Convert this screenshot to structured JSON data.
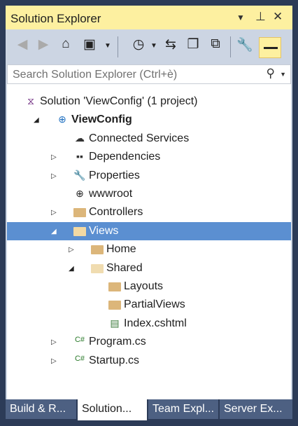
{
  "title": "Solution Explorer",
  "search": {
    "placeholder": "Search Solution Explorer (Ctrl+è)"
  },
  "tree": [
    {
      "label": "Solution 'ViewConfig' (1 project)",
      "icon": "solution-icon",
      "level": 0,
      "expander": ""
    },
    {
      "label": "ViewConfig",
      "icon": "web-project-icon",
      "level": 1,
      "expander": "expanded",
      "bold": true
    },
    {
      "label": "Connected Services",
      "icon": "cloud-icon",
      "level": 2,
      "expander": ""
    },
    {
      "label": "Dependencies",
      "icon": "dependencies-icon",
      "level": 2,
      "expander": "collapsed"
    },
    {
      "label": "Properties",
      "icon": "wrench-icon",
      "level": 2,
      "expander": "collapsed"
    },
    {
      "label": "wwwroot",
      "icon": "globe-icon",
      "level": 2,
      "expander": ""
    },
    {
      "label": "Controllers",
      "icon": "folder-icon",
      "level": 2,
      "expander": "collapsed"
    },
    {
      "label": "Views",
      "icon": "folder-open-icon",
      "level": 2,
      "expander": "expanded",
      "selected": true
    },
    {
      "label": "Home",
      "icon": "folder-icon",
      "level": 3,
      "expander": "collapsed"
    },
    {
      "label": "Shared",
      "icon": "folder-open-icon",
      "level": 3,
      "expander": "expanded"
    },
    {
      "label": "Layouts",
      "icon": "folder-icon",
      "level": 4,
      "expander": ""
    },
    {
      "label": "PartialViews",
      "icon": "folder-icon",
      "level": 4,
      "expander": ""
    },
    {
      "label": "Index.cshtml",
      "icon": "razor-file-icon",
      "level": 4,
      "expander": ""
    },
    {
      "label": "Program.cs",
      "icon": "csharp-icon",
      "level": 2,
      "expander": "collapsed"
    },
    {
      "label": "Startup.cs",
      "icon": "csharp-icon",
      "level": 2,
      "expander": "collapsed"
    }
  ],
  "tabs": [
    {
      "label": "Build & R..."
    },
    {
      "label": "Solution...",
      "active": true
    },
    {
      "label": "Team Expl..."
    },
    {
      "label": "Server Ex..."
    }
  ],
  "colors": {
    "title_bg": "#fdf0a0",
    "selection": "#5b8fd1",
    "tab_bg": "#4d6082"
  }
}
